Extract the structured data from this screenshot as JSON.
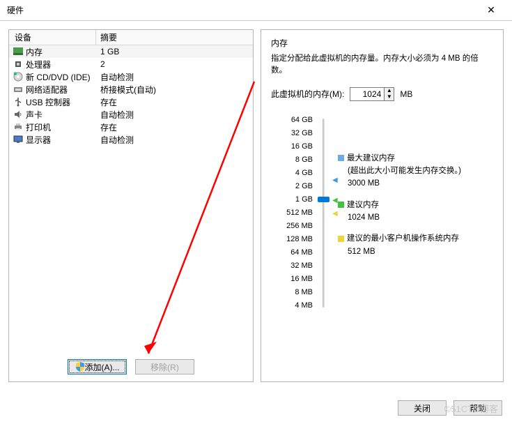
{
  "window": {
    "title": "硬件",
    "close": "✕"
  },
  "table": {
    "headers": {
      "device": "设备",
      "summary": "摘要"
    },
    "rows": [
      {
        "name": "内存",
        "summary": "1 GB",
        "icon": "memory"
      },
      {
        "name": "处理器",
        "summary": "2",
        "icon": "cpu"
      },
      {
        "name": "新 CD/DVD (IDE)",
        "summary": "自动检测",
        "icon": "cd"
      },
      {
        "name": "网络适配器",
        "summary": "桥接模式(自动)",
        "icon": "nic"
      },
      {
        "name": "USB 控制器",
        "summary": "存在",
        "icon": "usb"
      },
      {
        "name": "声卡",
        "summary": "自动检测",
        "icon": "sound"
      },
      {
        "name": "打印机",
        "summary": "存在",
        "icon": "printer"
      },
      {
        "name": "显示器",
        "summary": "自动检测",
        "icon": "display"
      }
    ]
  },
  "buttons": {
    "add": "添加(A)...",
    "remove": "移除(R)",
    "close": "关闭",
    "help": "帮助"
  },
  "right": {
    "title": "内存",
    "desc": "指定分配给此虚拟机的内存量。内存大小必须为 4 MB 的倍数。",
    "label": "此虚拟机的内存(M):",
    "value": "1024",
    "unit": "MB"
  },
  "slider": {
    "ticks": [
      "64 GB",
      "32 GB",
      "16 GB",
      "8 GB",
      "4 GB",
      "2 GB",
      "1 GB",
      "512 MB",
      "256 MB",
      "128 MB",
      "64 MB",
      "32 MB",
      "16 MB",
      "8 MB",
      "4 MB"
    ]
  },
  "legend": {
    "max": {
      "title": "最大建议内存",
      "desc": "(超出此大小可能发生内存交换。)",
      "val": "3000 MB"
    },
    "rec": {
      "title": "建议内存",
      "val": "1024 MB"
    },
    "min": {
      "title": "建议的最小客户机操作系统内存",
      "val": "512 MB"
    }
  },
  "watermark": "©51CTO博客"
}
